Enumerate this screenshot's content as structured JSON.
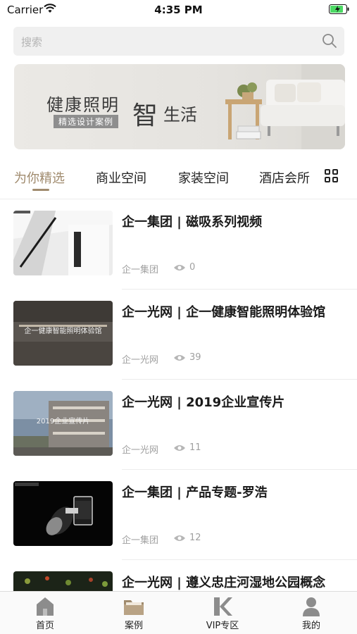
{
  "status_bar": {
    "carrier": "Carrier",
    "time": "4:35 PM"
  },
  "search": {
    "placeholder": "搜索"
  },
  "banner": {
    "title": "健康照明",
    "subtitle": "精选设计案例",
    "big_char": "智",
    "life": "生活"
  },
  "tabs": [
    {
      "label": "为你精选",
      "active": true
    },
    {
      "label": "商业空间",
      "active": false
    },
    {
      "label": "家装空间",
      "active": false
    },
    {
      "label": "酒店会所",
      "active": false
    }
  ],
  "feed": [
    {
      "title": "企一集团 | 磁吸系列视频",
      "source": "企一集团",
      "views": "0",
      "caption": ""
    },
    {
      "title": "企一光网 | 企一健康智能照明体验馆",
      "source": "企一光网",
      "views": "39",
      "caption": "企一健康智能照明体验馆"
    },
    {
      "title": "企一光网 | 2019企业宣传片",
      "source": "企一光网",
      "views": "11",
      "caption": "2019企业宣传片"
    },
    {
      "title": "企一集团 | 产品专题-罗浩",
      "source": "企一集团",
      "views": "12",
      "caption": ""
    },
    {
      "title": "企一光网 | 遵义忠庄河湿地公园概念",
      "source": "",
      "views": "",
      "caption": ""
    }
  ],
  "tabbar": [
    {
      "label": "首页",
      "icon": "home-icon"
    },
    {
      "label": "案例",
      "icon": "folder-icon"
    },
    {
      "label": "VIP专区",
      "icon": "vip-logo-icon"
    },
    {
      "label": "我的",
      "icon": "profile-icon"
    }
  ],
  "colors": {
    "accent": "#a08b6e",
    "muted": "#a0a0a0",
    "battery": "#4cd964"
  }
}
